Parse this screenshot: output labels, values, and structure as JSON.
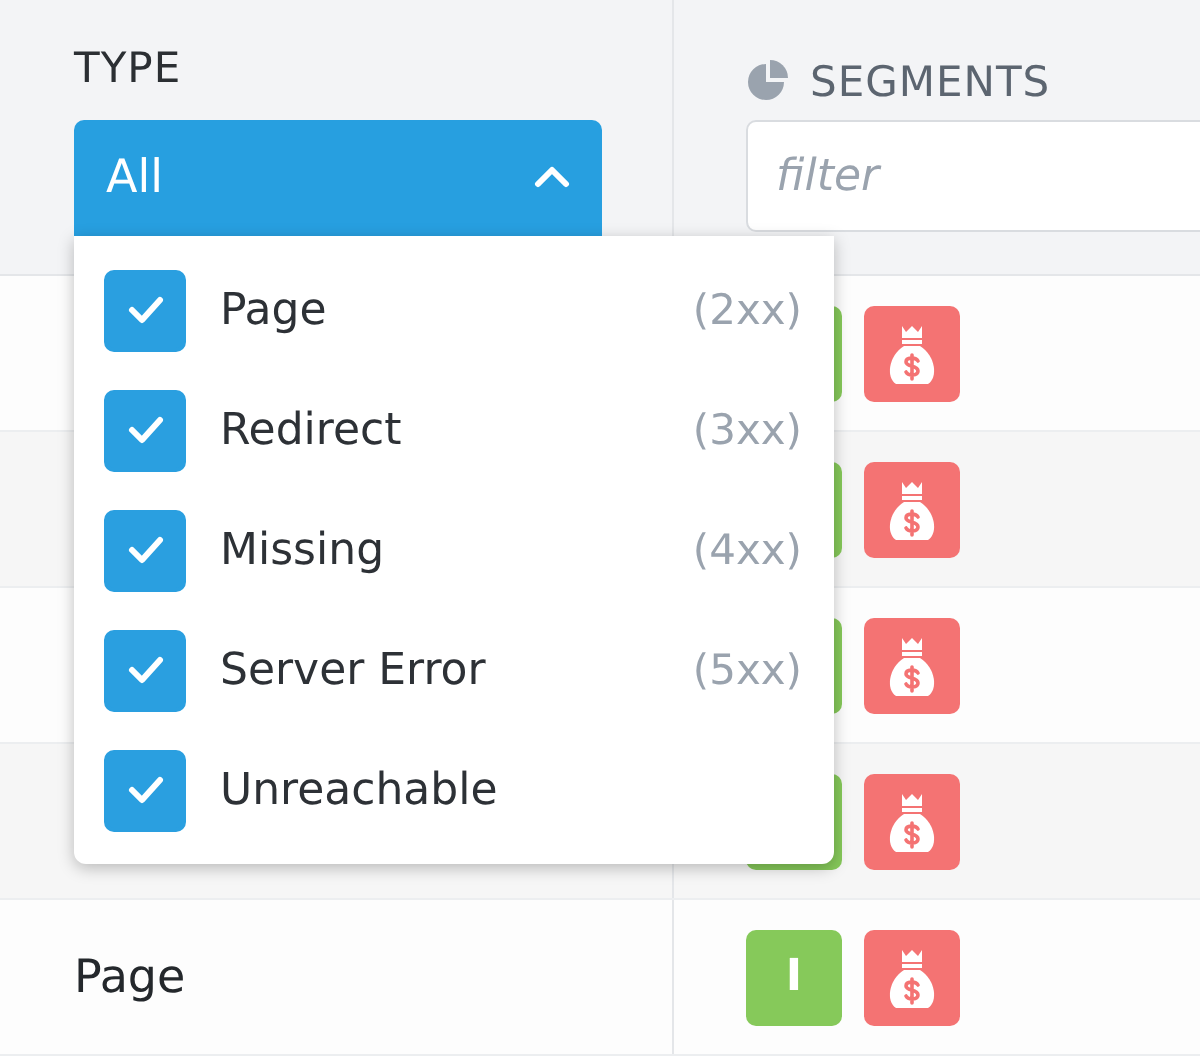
{
  "type_filter": {
    "label": "TYPE",
    "value": "All",
    "expanded": true,
    "options": [
      {
        "label": "Page",
        "code": "(2xx)",
        "checked": true
      },
      {
        "label": "Redirect",
        "code": "(3xx)",
        "checked": true
      },
      {
        "label": "Missing",
        "code": "(4xx)",
        "checked": true
      },
      {
        "label": "Server Error",
        "code": "(5xx)",
        "checked": true
      },
      {
        "label": "Unreachable",
        "checked": true
      }
    ]
  },
  "segments_filter": {
    "label": "SEGMENTS",
    "placeholder": "filter"
  },
  "rows": [
    {
      "badges": [
        {
          "kind": "letter"
        },
        {
          "kind": "money"
        }
      ]
    },
    {
      "badges": [
        {
          "kind": "letter"
        },
        {
          "kind": "money"
        }
      ]
    },
    {
      "badges": [
        {
          "kind": "letter"
        },
        {
          "kind": "money"
        }
      ]
    },
    {
      "badges": [
        {
          "kind": "letter"
        },
        {
          "kind": "money"
        }
      ]
    },
    {
      "type": "Page",
      "badges": [
        {
          "kind": "letter",
          "text": "I"
        },
        {
          "kind": "money"
        }
      ]
    }
  ]
}
